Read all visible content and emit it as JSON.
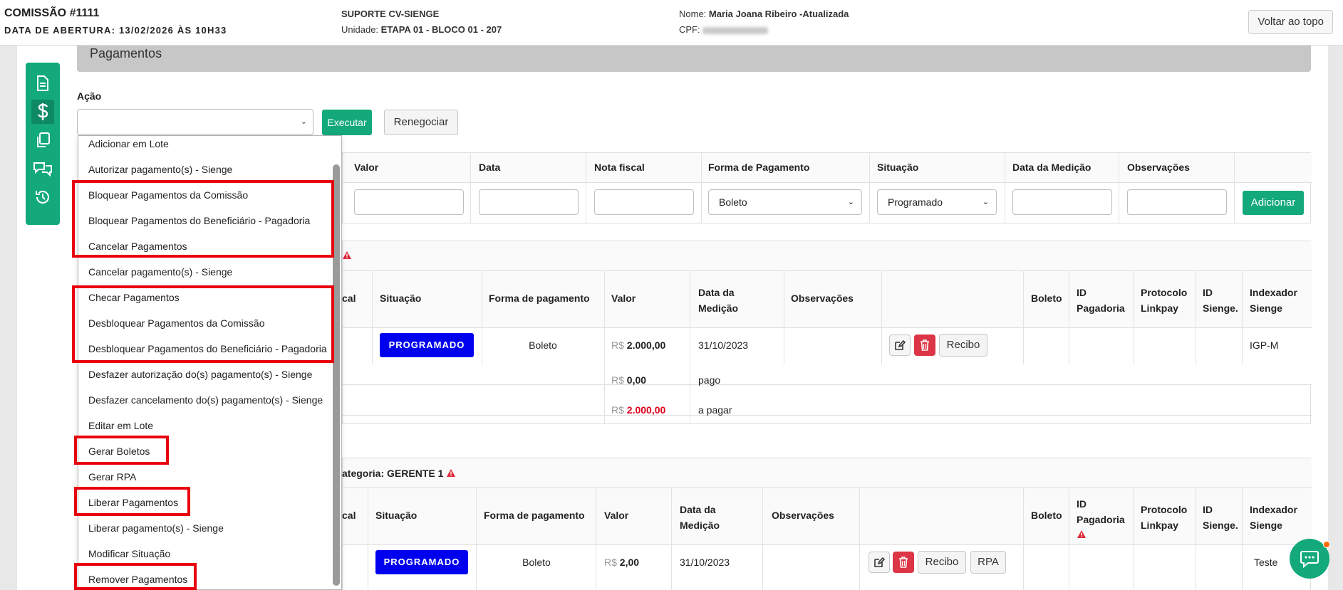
{
  "header": {
    "commission_title": "COMISSÃO #1111",
    "opening_date": "DATA DE ABERTURA: 13/02/2026 ÀS 10H33",
    "support_name": "SUPORTE CV-SIENGE",
    "unit_label": "Unidade:",
    "unit_value": "ETAPA 01 - BLOCO 01 - 207",
    "name_label": "Nome:",
    "name_value": "Maria Joana Ribeiro -Atualizada",
    "cpf_label": "CPF:",
    "back_to_top": "Voltar ao topo"
  },
  "section": {
    "title": "Pagamentos"
  },
  "action": {
    "label": "Ação",
    "execute": "Executar",
    "renegotiate": "Renegociar"
  },
  "dropdown_options": [
    "Adicionar em Lote",
    "Autorizar pagamento(s) - Sienge",
    "Bloquear Pagamentos da Comissão",
    "Bloquear Pagamentos do Beneficiário - Pagadoria",
    "Cancelar Pagamentos",
    "Cancelar pagamento(s) - Sienge",
    "Checar Pagamentos",
    "Desbloquear Pagamentos da Comissão",
    "Desbloquear Pagamentos do Beneficiário - Pagadoria",
    "Desfazer autorização do(s) pagamento(s) - Sienge",
    "Desfazer cancelamento do(s) pagamento(s) - Sienge",
    "Editar em Lote",
    "Gerar Boletos",
    "Gerar RPA",
    "Liberar Pagamentos",
    "Liberar pagamento(s) - Sienge",
    "Modificar Situação",
    "Remover Pagamentos"
  ],
  "add_form": {
    "columns": [
      "Valor",
      "Data",
      "Nota fiscal",
      "Forma de Pagamento",
      "Situação",
      "Data da Medição",
      "Observações"
    ],
    "forma_pagamento_value": "Boleto",
    "situacao_value": "Programado",
    "add_button": "Adicionar"
  },
  "table1": {
    "partial_col": "cal",
    "columns": [
      "Situação",
      "Forma de pagamento",
      "Valor",
      "Data da Medição",
      "Observações",
      "",
      "Boleto",
      "ID Pagadoria",
      "Protocolo Linkpay",
      "ID Sienge.",
      "Indexador Sienge"
    ],
    "row": {
      "situacao": "PROGRAMADO",
      "forma": "Boleto",
      "currency": "R$",
      "valor": "2.000,00",
      "data_medicao": "31/10/2023",
      "recibo": "Recibo",
      "indexador": "IGP-M"
    },
    "summary": [
      {
        "currency": "R$",
        "value": "0,00",
        "label": "pago"
      },
      {
        "currency": "R$",
        "value": "2.000,00",
        "label": "a pagar"
      }
    ]
  },
  "table2": {
    "category_title": "ategoria: GERENTE 1",
    "partial_col": "cal",
    "columns": [
      "Situação",
      "Forma de pagamento",
      "Valor",
      "Data da Medição",
      "Observações",
      "",
      "Boleto",
      "ID Pagadoria",
      "Protocolo Linkpay",
      "ID Sienge.",
      "Indexador Sienge"
    ],
    "row": {
      "situacao": "PROGRAMADO",
      "forma": "Boleto",
      "currency": "R$",
      "valor": "2,00",
      "data_medicao": "31/10/2023",
      "recibo": "Recibo",
      "rpa": "RPA",
      "indexador": "Teste"
    }
  },
  "icons": {
    "side": [
      "document-icon",
      "dollar-icon",
      "copy-icon",
      "chat-bubbles-icon",
      "history-icon"
    ],
    "accent": "#13a97b",
    "badge_color": "#0000ee",
    "highlight_color": "#e8000d"
  }
}
